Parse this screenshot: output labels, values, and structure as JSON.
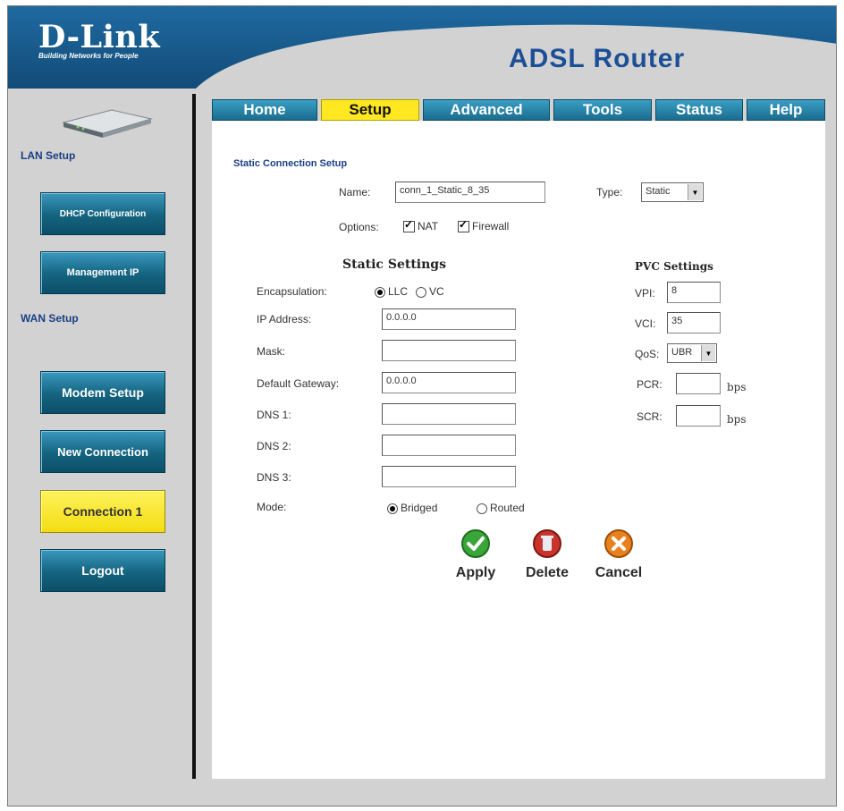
{
  "brand": {
    "logo": "D-Link",
    "tagline": "Building Networks for People",
    "product": "ADSL Router"
  },
  "tabs": [
    {
      "label": "Home"
    },
    {
      "label": "Setup"
    },
    {
      "label": "Advanced"
    },
    {
      "label": "Tools"
    },
    {
      "label": "Status"
    },
    {
      "label": "Help"
    }
  ],
  "active_tab": "Setup",
  "sidebar": {
    "lan_heading": "LAN Setup",
    "wan_heading": "WAN Setup",
    "buttons": [
      {
        "label": "DHCP Configuration"
      },
      {
        "label": "Management IP"
      },
      {
        "label": "Modem Setup"
      },
      {
        "label": "New Connection"
      },
      {
        "label": "Connection 1"
      },
      {
        "label": "Logout"
      }
    ],
    "active_button": "Connection 1"
  },
  "form": {
    "section_title": "Static Connection Setup",
    "name_label": "Name:",
    "name_value": "conn_1_Static_8_35",
    "type_label": "Type:",
    "type_value": "Static",
    "options_label": "Options:",
    "nat_label": "NAT",
    "firewall_label": "Firewall",
    "static_heading": "Static Settings",
    "encapsulation_label": "Encapsulation:",
    "llc_label": "LLC",
    "vc_label": "VC",
    "ip_label": "IP Address:",
    "ip_value": "0.0.0.0",
    "mask_label": "Mask:",
    "mask_value": "",
    "gateway_label": "Default Gateway:",
    "gateway_value": "0.0.0.0",
    "dns1_label": "DNS 1:",
    "dns2_label": "DNS 2:",
    "dns3_label": "DNS 3:",
    "mode_label": "Mode:",
    "bridged_label": "Bridged",
    "routed_label": "Routed",
    "pvc_heading": "PVC Settings",
    "vpi_label": "VPI:",
    "vpi_value": "8",
    "vci_label": "VCI:",
    "vci_value": "35",
    "qos_label": "QoS:",
    "qos_value": "UBR",
    "pcr_label": "PCR:",
    "scr_label": "SCR:",
    "bps_label": "bps"
  },
  "actions": {
    "apply": "Apply",
    "delete": "Delete",
    "cancel": "Cancel"
  },
  "colors": {
    "brand_blue": "#1d5e8c",
    "tab_blue": "#1a6d8f",
    "active_yellow": "#ffe822",
    "apply_green": "#3aa538",
    "delete_red": "#c8342c",
    "cancel_orange": "#e8801e"
  }
}
